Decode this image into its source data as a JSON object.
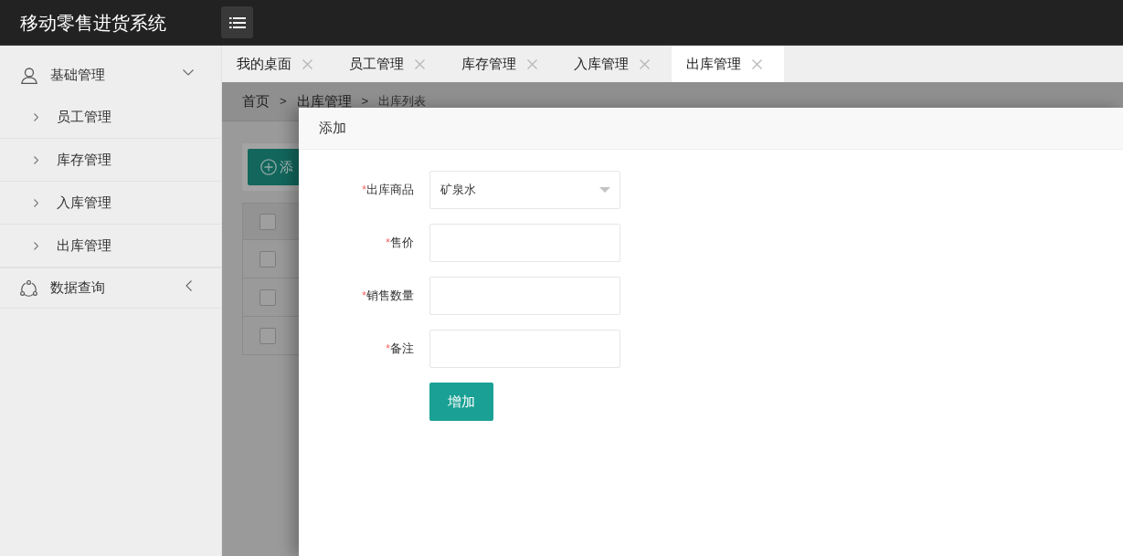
{
  "header": {
    "title": "移动零售进货系统"
  },
  "sidebar": {
    "groups": [
      {
        "label": "基础管理",
        "expanded": true,
        "children": [
          {
            "label": "员工管理"
          },
          {
            "label": "库存管理"
          },
          {
            "label": "入库管理"
          },
          {
            "label": "出库管理"
          }
        ]
      },
      {
        "label": "数据查询",
        "expanded": false
      }
    ]
  },
  "tabs": [
    {
      "label": "我的桌面",
      "selected": false
    },
    {
      "label": "员工管理",
      "selected": false
    },
    {
      "label": "库存管理",
      "selected": false
    },
    {
      "label": "入库管理",
      "selected": false
    },
    {
      "label": "出库管理",
      "selected": true
    }
  ],
  "breadcrumb": [
    {
      "kind": "link",
      "text": "首页"
    },
    {
      "kind": "separator",
      "text": ">"
    },
    {
      "kind": "link",
      "text": "出库管理"
    },
    {
      "kind": "separator",
      "text": ">"
    },
    {
      "kind": "current",
      "text": "出库列表"
    }
  ],
  "toolbar": {
    "add_button": "添"
  },
  "table": {
    "header_checked": false,
    "rows": [
      {
        "checked": false
      },
      {
        "checked": false
      },
      {
        "checked": false
      }
    ]
  },
  "dialog": {
    "title": "添加",
    "fields": [
      {
        "kind": "select",
        "required_mark": "*",
        "label": "出库商品",
        "value": "矿泉水"
      },
      {
        "kind": "text",
        "required_mark": "*",
        "label": "售价"
      },
      {
        "kind": "text",
        "required_mark": "*",
        "label": "销售数量"
      },
      {
        "kind": "text",
        "required_mark": "*",
        "label": "备注"
      }
    ],
    "submit": "增加"
  }
}
